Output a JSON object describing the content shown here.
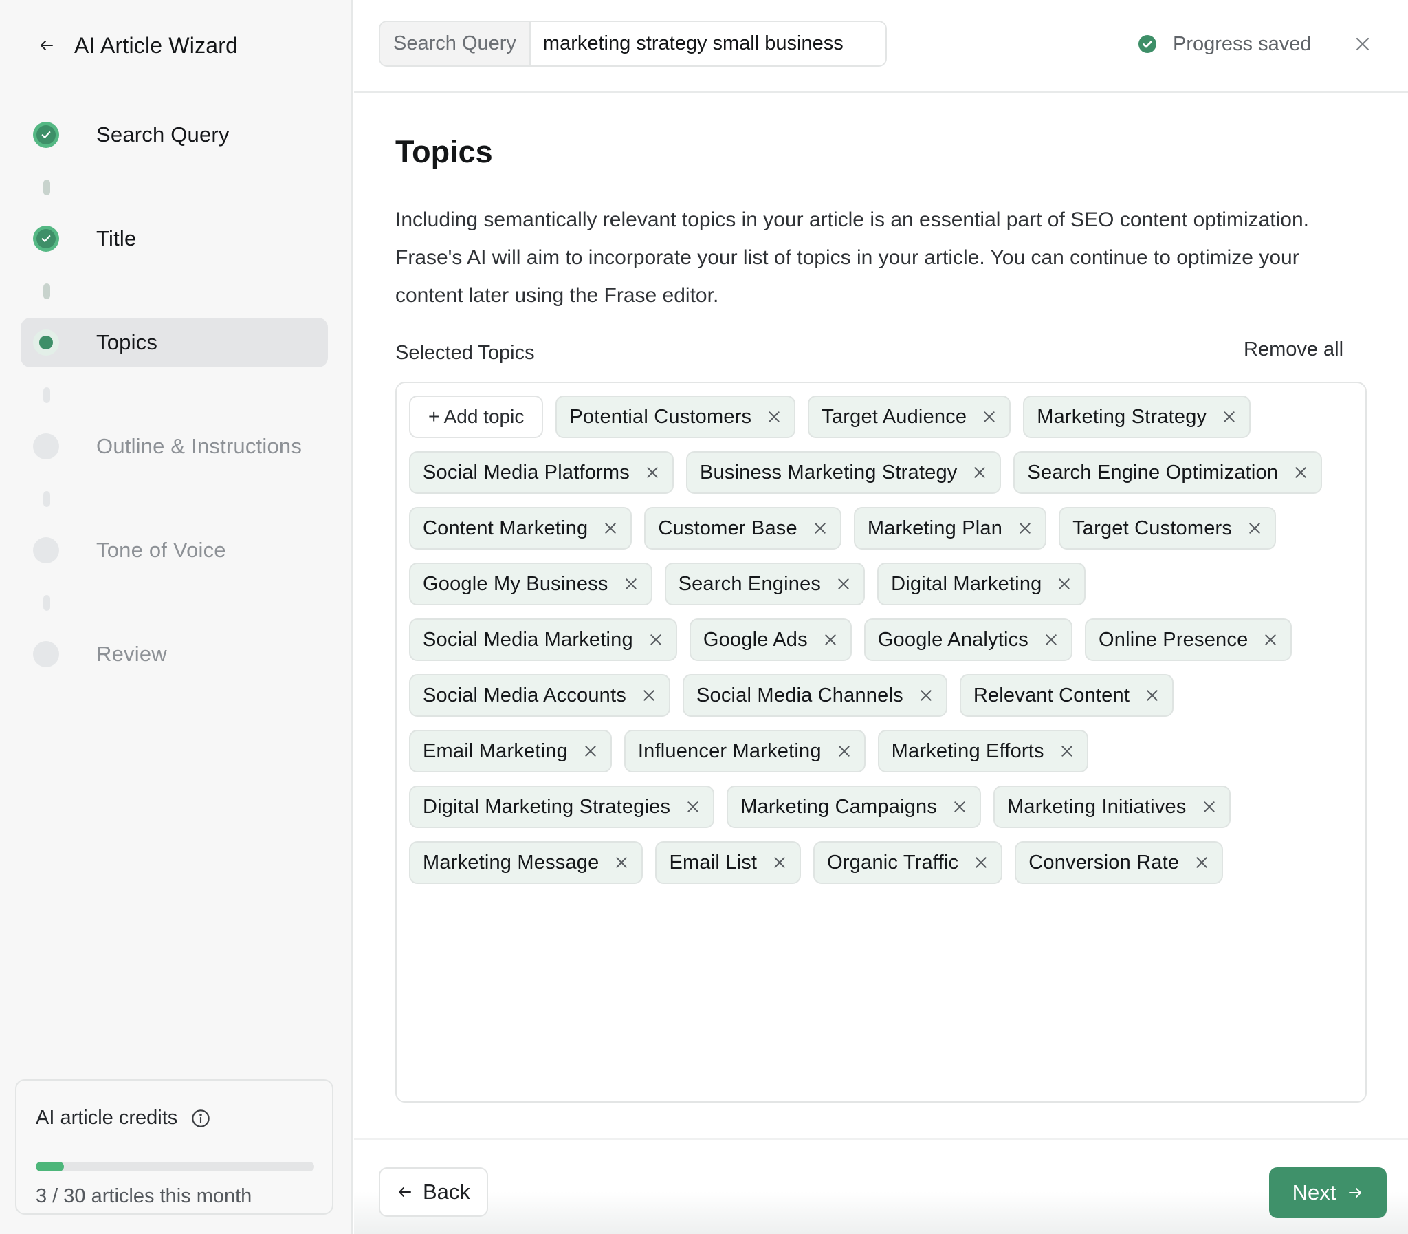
{
  "sidebar": {
    "title": "AI Article Wizard",
    "back_icon": "arrow-left-icon",
    "steps": [
      {
        "label": "Search Query",
        "status": "done"
      },
      {
        "label": "Title",
        "status": "done"
      },
      {
        "label": "Topics",
        "status": "current"
      },
      {
        "label": "Outline & Instructions",
        "status": "pending"
      },
      {
        "label": "Tone of Voice",
        "status": "pending"
      },
      {
        "label": "Review",
        "status": "pending"
      }
    ],
    "credits": {
      "title": "AI article credits",
      "info_icon": "info-icon",
      "used": 3,
      "total": 30,
      "text": "3 / 30 articles this month"
    }
  },
  "topbar": {
    "query_label": "Search Query",
    "query_value": "marketing strategy small business",
    "status_text": "Progress saved",
    "status_icon": "check-circle-icon",
    "close_icon": "close-icon"
  },
  "main": {
    "title": "Topics",
    "description": "Including semantically relevant topics in your article is an essential part of SEO content optimization. Frase's AI will aim to incorporate your list of topics in your article. You can continue to optimize your content later using the Frase editor.",
    "selected_label": "Selected Topics",
    "remove_all": "Remove all",
    "add_topic": "+ Add topic",
    "topics": [
      "Potential Customers",
      "Target Audience",
      "Marketing Strategy",
      "Social Media Platforms",
      "Business Marketing Strategy",
      "Search Engine Optimization",
      "Content Marketing",
      "Customer Base",
      "Marketing Plan",
      "Target Customers",
      "Google My Business",
      "Search Engines",
      "Digital Marketing",
      "Social Media Marketing",
      "Google Ads",
      "Google Analytics",
      "Online Presence",
      "Social Media Accounts",
      "Social Media Channels",
      "Relevant Content",
      "Email Marketing",
      "Influencer Marketing",
      "Marketing Efforts",
      "Digital Marketing Strategies",
      "Marketing Campaigns",
      "Marketing Initiatives",
      "Marketing Message",
      "Email List",
      "Organic Traffic",
      "Conversion Rate"
    ]
  },
  "footer": {
    "back_label": "Back",
    "next_label": "Next"
  },
  "colors": {
    "accent": "#3f916a",
    "accent_light": "#55b884",
    "chip_bg": "#ecf3ef",
    "progress_fill": "#4db67a"
  }
}
